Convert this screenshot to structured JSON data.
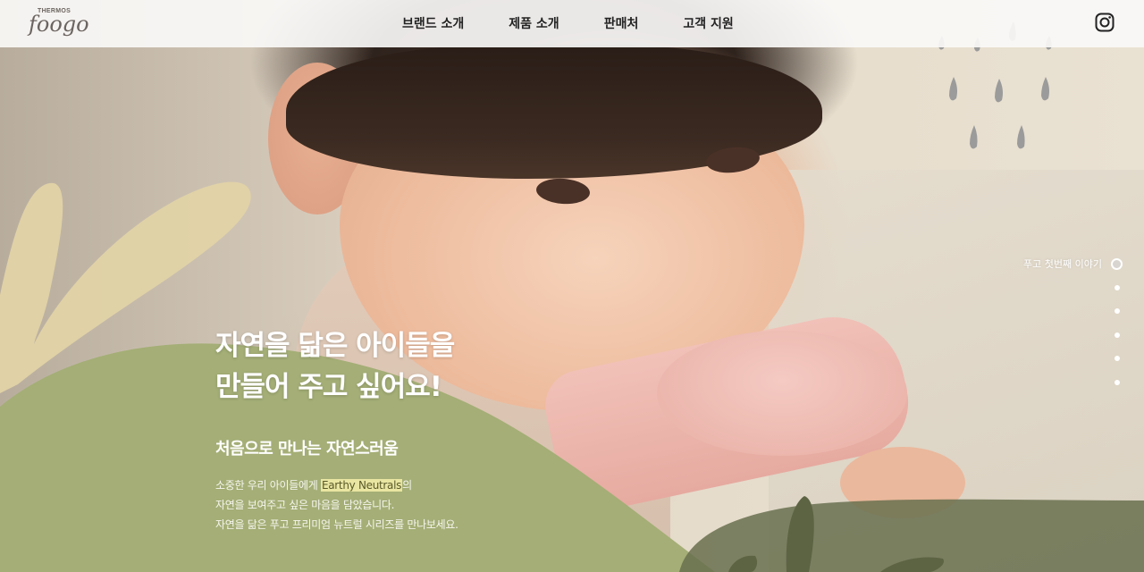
{
  "header": {
    "logo": {
      "small_text": "THERMOS",
      "main_text": "foogo"
    },
    "nav": [
      {
        "label": "브랜드 소개"
      },
      {
        "label": "제품 소개"
      },
      {
        "label": "판매처"
      },
      {
        "label": "고객 지원"
      }
    ],
    "social_icon": "instagram-icon"
  },
  "hero": {
    "headline_line1": "자연을 닮은 아이들을",
    "headline_line2": "만들어 주고 싶어요!",
    "subheadline": "처음으로 만나는 자연스러움",
    "desc_line1_before": "소중한 우리 아이들에게 ",
    "desc_line1_highlight": "Earthy Neutrals",
    "desc_line1_after": "의",
    "desc_line2": "자연을 보여주고 싶은 마음을 담았습니다.",
    "desc_line3": "자연을 닮은 푸고 프리미엄 뉴트럴 시리즈를 만나보세요."
  },
  "pager": {
    "active_label": "푸고 첫번째 이야기",
    "total": 6,
    "active_index": 0
  },
  "colors": {
    "header_bg": "#faf9f7",
    "sage_green": "#a4ae76",
    "dark_olive": "#69704f",
    "sand_beige": "#e2d3a6",
    "rain_gray": "#9b9b9b",
    "highlight_bg": "#f6f0aa",
    "text_white": "#ffffff"
  }
}
